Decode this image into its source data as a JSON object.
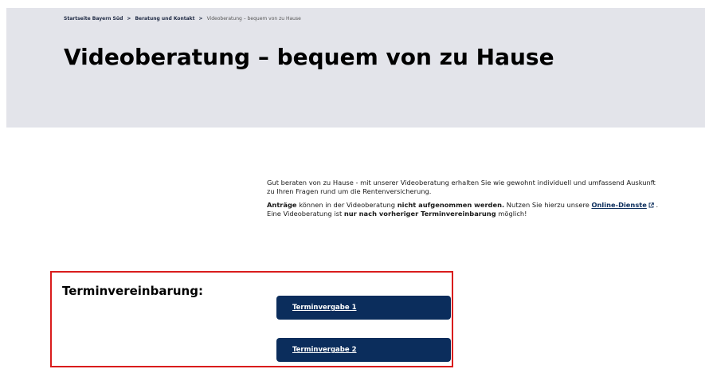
{
  "breadcrumb": {
    "items": [
      "Startseite Bayern Süd",
      "Beratung und Kontakt"
    ],
    "separator": ">",
    "current": "Videoberatung – bequem von zu Hause"
  },
  "page_title": "Videoberatung – bequem von zu Hause",
  "intro": {
    "paragraph1": "Gut beraten von zu Hause - mit unserer Videoberatung erhalten Sie wie gewohnt individuell und umfassend Auskunft zu Ihren Fragen rund um die Rentenversicherung.",
    "p2_bold1": "Anträge",
    "p2_text1": " können in der Videoberatung ",
    "p2_bold2": "nicht aufgenommen werden.",
    "p2_text2": " Nutzen Sie hierzu unsere ",
    "p2_link": "Online-Dienste",
    "p2_after_link": " .",
    "p3_text1": "Eine Videoberatung ist ",
    "p3_bold": "nur nach vorheriger Terminvereinbarung",
    "p3_text2": " möglich!",
    "link_icon": "external-link-icon"
  },
  "termin": {
    "heading": "Terminvereinbarung:",
    "buttons": [
      "Terminvergabe 1",
      "Terminvergabe 2"
    ]
  },
  "colors": {
    "hero_bg": "#e3e4ea",
    "primary": "#0b2d5c",
    "highlight_border": "#d91c1c"
  }
}
